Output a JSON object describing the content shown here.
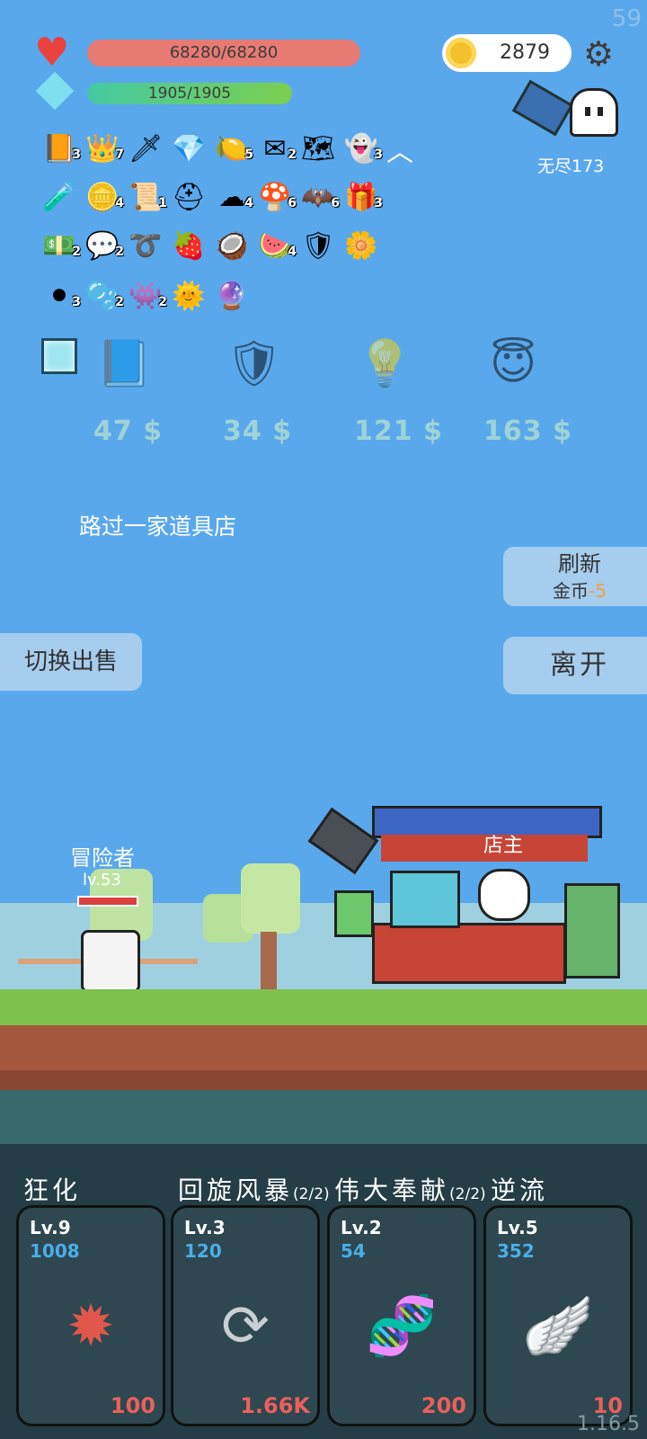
{
  "fps": "59",
  "hp_text": "68280/68280",
  "mp_text": "1905/1905",
  "gold": "2879",
  "endless_label": "无尽173",
  "inventory": [
    {
      "icon": "book",
      "glyph": "📙",
      "count": "3"
    },
    {
      "icon": "crown",
      "glyph": "👑",
      "count": "7"
    },
    {
      "icon": "sword",
      "glyph": "🗡",
      "count": ""
    },
    {
      "icon": "ruby",
      "glyph": "💎",
      "count": ""
    },
    {
      "icon": "lime",
      "glyph": "🍋",
      "count": "5"
    },
    {
      "icon": "envelope",
      "glyph": "✉",
      "count": "2"
    },
    {
      "icon": "map",
      "glyph": "🗺",
      "count": ""
    },
    {
      "icon": "ghost",
      "glyph": "👻",
      "count": "3"
    },
    {
      "icon": "potion",
      "glyph": "🧪",
      "count": ""
    },
    {
      "icon": "coins",
      "glyph": "🪙",
      "count": "4"
    },
    {
      "icon": "treasure-map",
      "glyph": "📜",
      "count": "1"
    },
    {
      "icon": "viking-helmet",
      "glyph": "⛑",
      "count": ""
    },
    {
      "icon": "cloud",
      "glyph": "☁",
      "count": "4"
    },
    {
      "icon": "mushroom",
      "glyph": "🍄",
      "count": "6"
    },
    {
      "icon": "bat",
      "glyph": "🦇",
      "count": "6"
    },
    {
      "icon": "gift-box",
      "glyph": "🎁",
      "count": "3"
    },
    {
      "icon": "money-heart",
      "glyph": "💵",
      "count": "2"
    },
    {
      "icon": "speech-bubble",
      "glyph": "💬",
      "count": "2"
    },
    {
      "icon": "noose",
      "glyph": "➰",
      "count": ""
    },
    {
      "icon": "strawberry",
      "glyph": "🍓",
      "count": ""
    },
    {
      "icon": "coconut",
      "glyph": "🥥",
      "count": ""
    },
    {
      "icon": "watermelon",
      "glyph": "🍉",
      "count": "4"
    },
    {
      "icon": "shield",
      "glyph": "🛡",
      "count": ""
    },
    {
      "icon": "flower",
      "glyph": "🌼",
      "count": ""
    },
    {
      "icon": "cauldron",
      "glyph": "⚫",
      "count": "3"
    },
    {
      "icon": "bubble-flask",
      "glyph": "🫧",
      "count": "2"
    },
    {
      "icon": "slime-monster",
      "glyph": "👾",
      "count": "2"
    },
    {
      "icon": "sun-orb",
      "glyph": "🌞",
      "count": ""
    },
    {
      "icon": "crystal-ball",
      "glyph": "🔮",
      "count": ""
    }
  ],
  "shop_offers": [
    {
      "icon": "grey-book",
      "glyph": "📘",
      "price": "47 $"
    },
    {
      "icon": "round-shield",
      "glyph": "🛡",
      "price": "34 $"
    },
    {
      "icon": "light-bulb",
      "glyph": "💡",
      "price": "121 $"
    },
    {
      "icon": "angel-wings-halo",
      "glyph": "😇",
      "price": "163 $"
    }
  ],
  "event_message": "路过一家道具店",
  "refresh_button": {
    "label": "刷新",
    "cost_label": "金币",
    "cost_value": "-5"
  },
  "leave_button": "离开",
  "switch_sell_button": "切换出售",
  "adventurer": {
    "label": "冒险者",
    "level": "lv.53"
  },
  "shopkeeper_label": "店主",
  "skills": [
    {
      "name": "狂化",
      "suffix": "",
      "level": "Lv.9",
      "value": "1008",
      "cost": "100",
      "icon": "burst",
      "glyph": "✹",
      "color": "#e2574b"
    },
    {
      "name": "回旋风暴",
      "suffix": "(2/2)",
      "level": "Lv.3",
      "value": "120",
      "cost": "1.66K",
      "icon": "cycle-arrows",
      "glyph": "⟳",
      "color": "#c9cfd2"
    },
    {
      "name": "伟大奉献",
      "suffix": "(2/2)",
      "level": "Lv.2",
      "value": "54",
      "cost": "200",
      "icon": "dna",
      "glyph": "🧬",
      "color": "#d9456a"
    },
    {
      "name": "逆流",
      "suffix": "",
      "level": "Lv.5",
      "value": "352",
      "cost": "10",
      "icon": "wing",
      "glyph": "🪽",
      "color": "#ffffff"
    }
  ],
  "version": "1.16.5"
}
